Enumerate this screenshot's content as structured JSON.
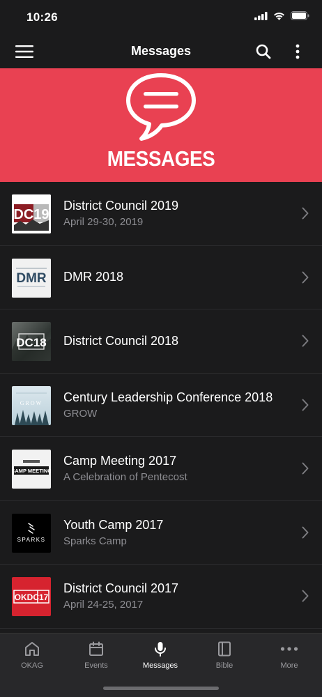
{
  "status": {
    "time": "10:26"
  },
  "nav": {
    "title": "Messages"
  },
  "hero": {
    "title": "MESSAGES"
  },
  "items": [
    {
      "title": "District Council 2019",
      "subtitle": "April 29-30, 2019",
      "thumb_text": "DC19"
    },
    {
      "title": "DMR 2018",
      "subtitle": "",
      "thumb_text": "DMR"
    },
    {
      "title": "District Council 2018",
      "subtitle": "",
      "thumb_text": "DC18"
    },
    {
      "title": "Century Leadership Conference 2018",
      "subtitle": "GROW",
      "thumb_text": "GROW"
    },
    {
      "title": "Camp Meeting 2017",
      "subtitle": "A Celebration of Pentecost",
      "thumb_text": "CAMP MEETING"
    },
    {
      "title": "Youth Camp 2017",
      "subtitle": "Sparks Camp",
      "thumb_text": "SPARKS"
    },
    {
      "title": "District Council 2017",
      "subtitle": "April 24-25, 2017",
      "thumb_text": "OKDC17"
    }
  ],
  "tabs": [
    {
      "label": "OKAG",
      "icon": "home-icon"
    },
    {
      "label": "Events",
      "icon": "calendar-icon"
    },
    {
      "label": "Messages",
      "icon": "microphone-icon"
    },
    {
      "label": "Bible",
      "icon": "book-icon"
    },
    {
      "label": "More",
      "icon": "more-icon"
    }
  ],
  "colors": {
    "accent": "#e94152",
    "background": "#1b1b1c",
    "tab_bar": "#28282a"
  }
}
